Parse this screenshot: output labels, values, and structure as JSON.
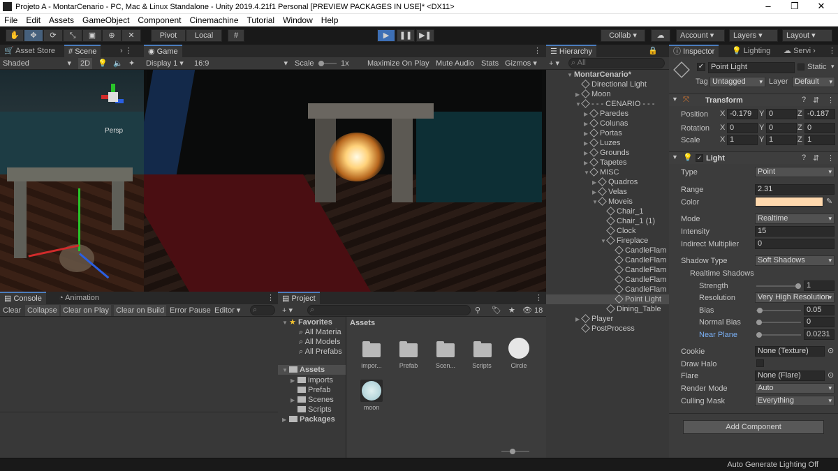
{
  "window": {
    "title": "Projeto A - MontarCenario - PC, Mac & Linux Standalone - Unity 2019.4.21f1 Personal [PREVIEW PACKAGES IN USE]* <DX11>"
  },
  "menu": [
    "File",
    "Edit",
    "Assets",
    "GameObject",
    "Component",
    "Cinemachine",
    "Tutorial",
    "Window",
    "Help"
  ],
  "toolbar": {
    "pivot": "Pivot",
    "local": "Local",
    "collab": "Collab",
    "account": "Account",
    "layers": "Layers",
    "layout": "Layout"
  },
  "tabs": {
    "asset_store": "Asset Store",
    "scene": "Scene",
    "game": "Game",
    "hierarchy": "Hierarchy",
    "inspector": "Inspector",
    "lighting": "Lighting",
    "services": "Servi",
    "console": "Console",
    "animation": "Animation",
    "project": "Project"
  },
  "scene_bar": {
    "shaded": "Shaded",
    "two_d": "2D",
    "persp": "Persp"
  },
  "game_bar": {
    "display": "Display 1",
    "aspect": "16:9",
    "scale_label": "Scale",
    "scale_value": "1x",
    "maximize": "Maximize On Play",
    "mute": "Mute Audio",
    "stats": "Stats",
    "gizmos": "Gizmos"
  },
  "hierarchy": {
    "search_placeholder": "All",
    "items": [
      {
        "label": "MontarCenario*",
        "depth": 0,
        "arrow": "▼"
      },
      {
        "label": "Directional Light",
        "depth": 1,
        "arrow": ""
      },
      {
        "label": "Moon",
        "depth": 1,
        "arrow": "▶"
      },
      {
        "label": "- - - CENARIO - - -",
        "depth": 1,
        "arrow": "▼"
      },
      {
        "label": "Paredes",
        "depth": 2,
        "arrow": "▶"
      },
      {
        "label": "Colunas",
        "depth": 2,
        "arrow": "▶"
      },
      {
        "label": "Portas",
        "depth": 2,
        "arrow": "▶"
      },
      {
        "label": "Luzes",
        "depth": 2,
        "arrow": "▶"
      },
      {
        "label": "Grounds",
        "depth": 2,
        "arrow": "▶"
      },
      {
        "label": "Tapetes",
        "depth": 2,
        "arrow": "▶"
      },
      {
        "label": "MISC",
        "depth": 2,
        "arrow": "▼"
      },
      {
        "label": "Quadros",
        "depth": 3,
        "arrow": "▶"
      },
      {
        "label": "Velas",
        "depth": 3,
        "arrow": "▶"
      },
      {
        "label": "Moveis",
        "depth": 3,
        "arrow": "▼"
      },
      {
        "label": "Chair_1",
        "depth": 4,
        "arrow": ""
      },
      {
        "label": "Chair_1 (1)",
        "depth": 4,
        "arrow": ""
      },
      {
        "label": "Clock",
        "depth": 4,
        "arrow": ""
      },
      {
        "label": "Fireplace",
        "depth": 4,
        "arrow": "▼"
      },
      {
        "label": "CandleFlam",
        "depth": 5,
        "arrow": ""
      },
      {
        "label": "CandleFlam",
        "depth": 5,
        "arrow": ""
      },
      {
        "label": "CandleFlam",
        "depth": 5,
        "arrow": ""
      },
      {
        "label": "CandleFlam",
        "depth": 5,
        "arrow": ""
      },
      {
        "label": "CandleFlam",
        "depth": 5,
        "arrow": ""
      },
      {
        "label": "Point Light",
        "depth": 5,
        "arrow": "",
        "selected": true
      },
      {
        "label": "Dining_Table",
        "depth": 4,
        "arrow": ""
      },
      {
        "label": "Player",
        "depth": 1,
        "arrow": "▶"
      },
      {
        "label": "PostProcess",
        "depth": 1,
        "arrow": ""
      }
    ]
  },
  "inspector": {
    "object_name": "Point Light",
    "static_label": "Static",
    "tag_label": "Tag",
    "tag_value": "Untagged",
    "layer_label": "Layer",
    "layer_value": "Default",
    "transform": {
      "title": "Transform",
      "position_label": "Position",
      "rotation_label": "Rotation",
      "scale_label": "Scale",
      "position": [
        "-0.179",
        "0",
        "-0.187"
      ],
      "rotation": [
        "0",
        "0",
        "0"
      ],
      "scale": [
        "1",
        "1",
        "1"
      ]
    },
    "light": {
      "title": "Light",
      "type_label": "Type",
      "type_value": "Point",
      "range_label": "Range",
      "range_value": "2.31",
      "color_label": "Color",
      "color_value": "#ffd9ae",
      "mode_label": "Mode",
      "mode_value": "Realtime",
      "intensity_label": "Intensity",
      "intensity_value": "15",
      "indirect_label": "Indirect Multiplier",
      "indirect_value": "0",
      "shadow_type_label": "Shadow Type",
      "shadow_type_value": "Soft Shadows",
      "realtime_shadows_label": "Realtime Shadows",
      "strength_label": "Strength",
      "strength_value": "1",
      "strength_fraction": 1.0,
      "resolution_label": "Resolution",
      "resolution_value": "Very High Resolution",
      "bias_label": "Bias",
      "bias_value": "0.05",
      "bias_fraction": 0.02,
      "normal_bias_label": "Normal Bias",
      "normal_bias_value": "0",
      "normal_bias_fraction": 0.0,
      "near_plane_label": "Near Plane",
      "near_plane_value": "0.0231",
      "near_plane_fraction": 0.0,
      "cookie_label": "Cookie",
      "cookie_value": "None (Texture)",
      "draw_halo_label": "Draw Halo",
      "flare_label": "Flare",
      "flare_value": "None (Flare)",
      "render_mode_label": "Render Mode",
      "render_mode_value": "Auto",
      "culling_label": "Culling Mask",
      "culling_value": "Everything"
    },
    "add_component": "Add Component"
  },
  "console_bar": {
    "clear": "Clear",
    "collapse": "Collapse",
    "clear_on_play": "Clear on Play",
    "clear_on_build": "Clear on Build",
    "error_pause": "Error Pause",
    "editor": "Editor"
  },
  "project": {
    "hidden_count": "18",
    "favorites": "Favorites",
    "fav_items": [
      "All Materia",
      "All Models",
      "All Prefabs"
    ],
    "assets_root": "Assets",
    "asset_tree": [
      "imports",
      "Prefab",
      "Scenes",
      "Scripts"
    ],
    "packages": "Packages",
    "breadcrumb": "Assets",
    "grid": [
      "impor...",
      "Prefab",
      "Scen...",
      "Scripts",
      "Circle",
      "moon"
    ]
  },
  "statusbar": {
    "text": "Auto Generate Lighting Off"
  },
  "colors": {
    "accent": "#4b7dbd",
    "play_active": "#3d6fb5",
    "selected_row": "#4d4d4d"
  }
}
